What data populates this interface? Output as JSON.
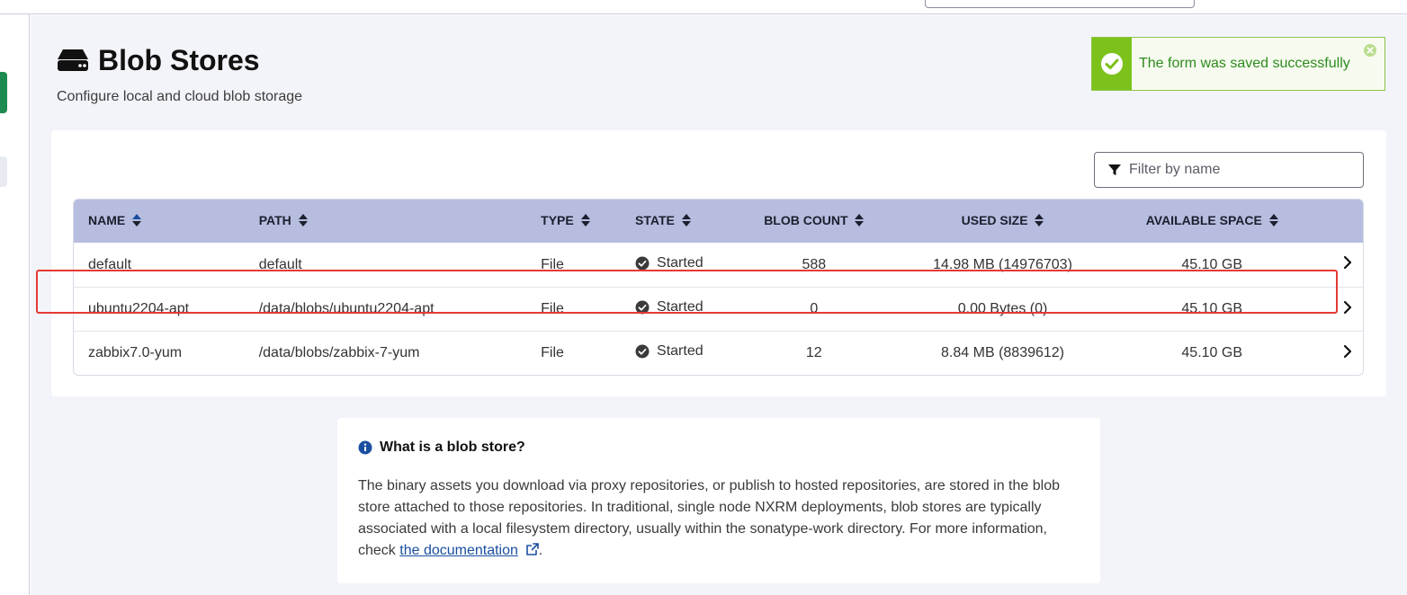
{
  "header": {
    "title": "Blob Stores",
    "subtitle": "Configure local and cloud blob storage"
  },
  "toast": {
    "message": "The form was saved successfully",
    "accent": "#7cc21b",
    "text_color": "#2e8b1e"
  },
  "filter": {
    "placeholder": "Filter by name",
    "value": ""
  },
  "table": {
    "columns": [
      "NAME",
      "PATH",
      "TYPE",
      "STATE",
      "BLOB COUNT",
      "USED SIZE",
      "AVAILABLE SPACE"
    ],
    "header_bg": "#b6bddf",
    "rows": [
      {
        "name": "default",
        "path": "default",
        "type": "File",
        "state": "Started",
        "blob_count": "588",
        "used_size": "14.98 MB (14976703)",
        "available_space": "45.10 GB"
      },
      {
        "name": "ubuntu2204-apt",
        "path": "/data/blobs/ubuntu2204-apt",
        "type": "File",
        "state": "Started",
        "blob_count": "0",
        "used_size": "0.00 Bytes (0)",
        "available_space": "45.10 GB"
      },
      {
        "name": "zabbix7.0-yum",
        "path": "/data/blobs/zabbix-7-yum",
        "type": "File",
        "state": "Started",
        "blob_count": "12",
        "used_size": "8.84 MB (8839612)",
        "available_space": "45.10 GB"
      }
    ],
    "highlight_color": "#e53935"
  },
  "info": {
    "title": "What is a blob store?",
    "body": "The binary assets you download via proxy repositories, or publish to hosted repositories, are stored in the blob store attached to those repositories. In traditional, single node NXRM deployments, blob stores are typically associated with a local filesystem directory, usually within the sonatype-work directory. For more information, check ",
    "link_text": "the documentation",
    "end": "."
  },
  "icons": {
    "title": "hard-drive-icon",
    "toast": "check-circle-icon",
    "close": "close-circle-icon",
    "filter": "funnel-icon",
    "sort": "sort-icon",
    "state": "check-circle-icon",
    "row": "chevron-right-icon",
    "info": "info-circle-icon",
    "external": "external-link-icon"
  }
}
